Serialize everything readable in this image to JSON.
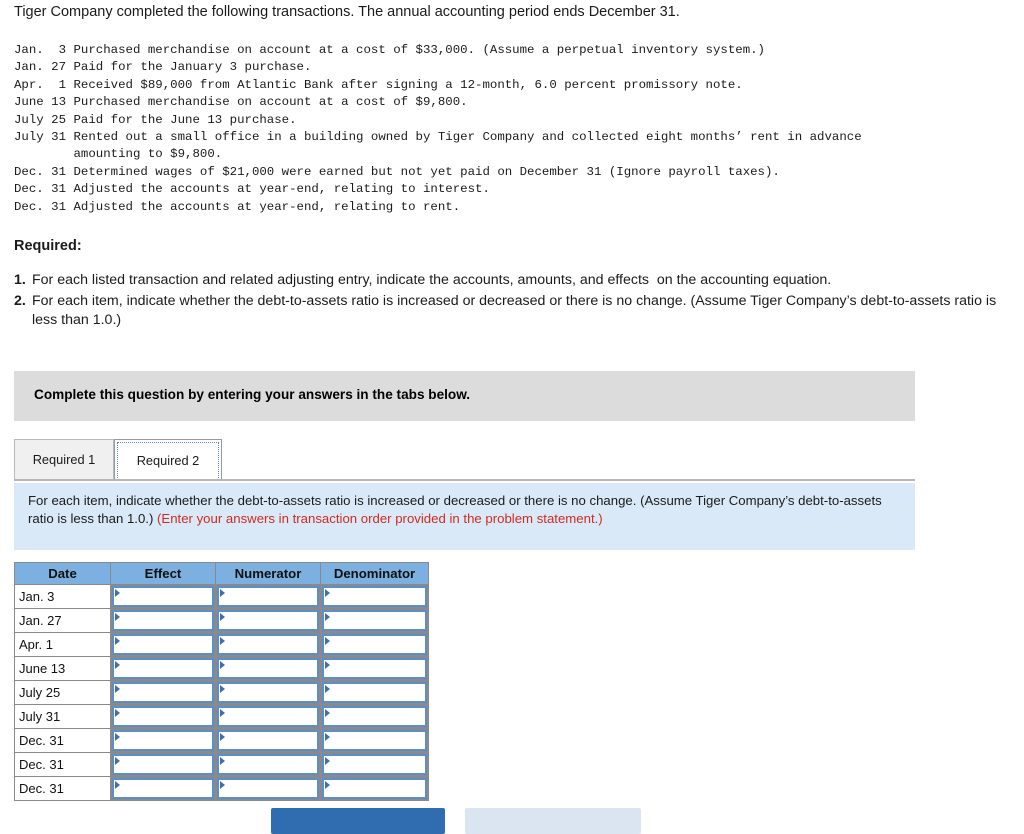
{
  "intro": {
    "text": "Tiger Company completed the following transactions. The annual accounting period ends December 31."
  },
  "transactions": [
    "Jan.  3 Purchased merchandise on account at a cost of $33,000. (Assume a perpetual inventory system.)",
    "Jan. 27 Paid for the January 3 purchase.",
    "Apr.  1 Received $89,000 from Atlantic Bank after signing a 12-month, 6.0 percent promissory note.",
    "June 13 Purchased merchandise on account at a cost of $9,800.",
    "July 25 Paid for the June 13 purchase.",
    "July 31 Rented out a small office in a building owned by Tiger Company and collected eight months’ rent in advance",
    "        amounting to $9,800.",
    "Dec. 31 Determined wages of $21,000 were earned but not yet paid on December 31 (Ignore payroll taxes).",
    "Dec. 31 Adjusted the accounts at year-end, relating to interest.",
    "Dec. 31 Adjusted the accounts at year-end, relating to rent."
  ],
  "required": {
    "heading": "Required:",
    "items": [
      {
        "num": "1.",
        "text": "For each listed transaction and related adjusting entry, indicate the accounts, amounts, and effects  on the accounting equation."
      },
      {
        "num": "2.",
        "text": "For each item, indicate whether the debt-to-assets ratio is increased or decreased or there is no change. (Assume Tiger Company’s debt-to-assets ratio is less than 1.0.)"
      }
    ]
  },
  "complete_band": {
    "text": "Complete this question by entering your answers in the tabs below."
  },
  "tabs": [
    {
      "label": "Required 1",
      "active": false
    },
    {
      "label": "Required 2",
      "active": true
    }
  ],
  "instruction_panel": {
    "black_text": "For each item, indicate whether the debt-to-assets ratio is increased or decreased or there is no change. (Assume Tiger Company’s debt-to-assets ratio is less than 1.0.) ",
    "red_text": "(Enter your answers in transaction order provided in the problem statement.)"
  },
  "answer_table": {
    "columns": [
      "Date",
      "Effect",
      "Numerator",
      "Denominator"
    ],
    "rows": [
      {
        "date": "Jan. 3",
        "effect": "",
        "numerator": "",
        "denominator": ""
      },
      {
        "date": "Jan. 27",
        "effect": "",
        "numerator": "",
        "denominator": ""
      },
      {
        "date": "Apr. 1",
        "effect": "",
        "numerator": "",
        "denominator": ""
      },
      {
        "date": "June 13",
        "effect": "",
        "numerator": "",
        "denominator": ""
      },
      {
        "date": "July 25",
        "effect": "",
        "numerator": "",
        "denominator": ""
      },
      {
        "date": "July 31",
        "effect": "",
        "numerator": "",
        "denominator": ""
      },
      {
        "date": "Dec. 31",
        "effect": "",
        "numerator": "",
        "denominator": ""
      },
      {
        "date": "Dec. 31",
        "effect": "",
        "numerator": "",
        "denominator": ""
      },
      {
        "date": "Dec. 31",
        "effect": "",
        "numerator": "",
        "denominator": ""
      }
    ]
  },
  "buttons": {
    "primary": "",
    "secondary": ""
  },
  "colors": {
    "table_header_blue": "#7cb0e0",
    "panel_blue": "#d9e9f7",
    "band_grey": "#dcdcdc",
    "red_note": "#d02b20",
    "primary_button": "#2f6db0",
    "secondary_button": "#dbe5f1",
    "dropdown_border": "#5b8fc9"
  }
}
